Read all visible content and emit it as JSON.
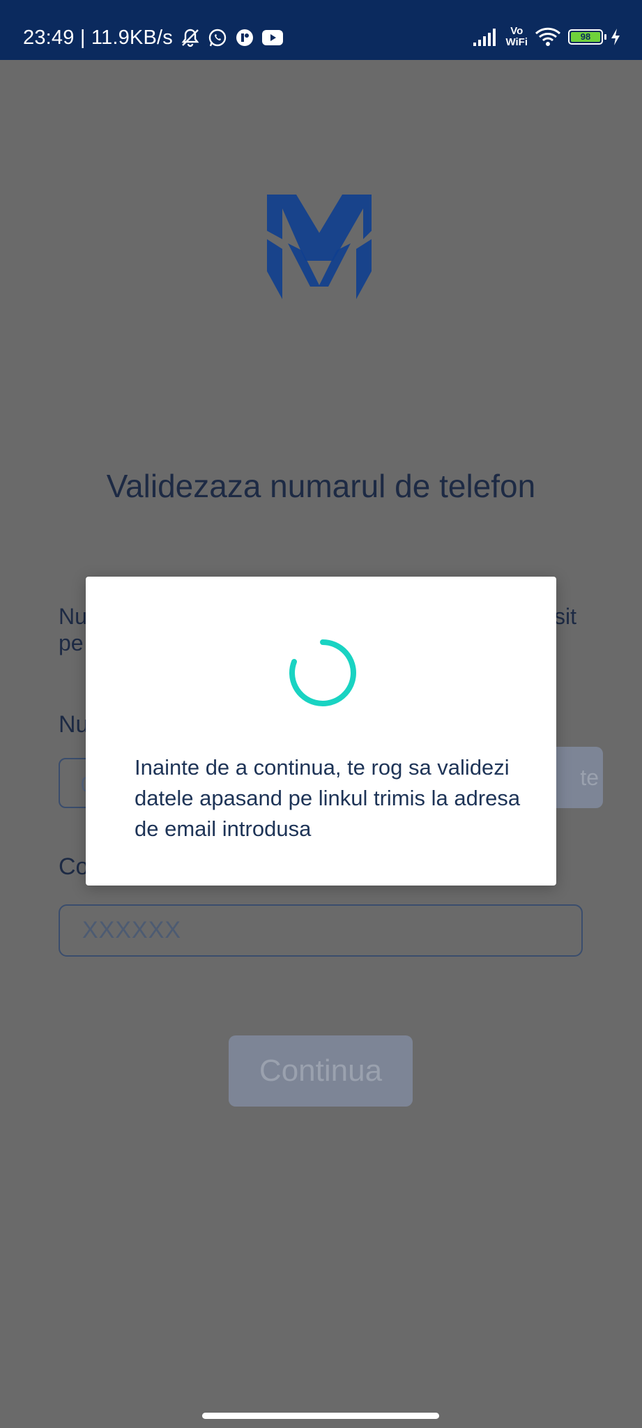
{
  "status_bar": {
    "time_speed": "23:49 | 11.9KB/s",
    "vowifi_line1": "Vo",
    "vowifi_line2": "WiFi",
    "battery_level": "98",
    "icons": [
      "bell-muted-icon",
      "whatsapp-icon",
      "app-icon",
      "youtube-icon",
      "signal-icon",
      "wifi-icon",
      "battery-icon",
      "charging-icon"
    ]
  },
  "page": {
    "title": "Validezaza numarul de telefon",
    "description_left": "Nu\npe",
    "description_right": "sit",
    "phone_label": "Nu",
    "phone_placeholder_fragment": "0",
    "send_button_fragment": "te",
    "code_label": "Co",
    "code_placeholder": "XXXXXX",
    "continue_label": "Continua"
  },
  "modal": {
    "message": "Inainte de a continua, te rog sa validezi datele apasand pe linkul trimis la adresa de email introdusa"
  },
  "colors": {
    "status_bar": "#0b2a5e",
    "overlay": "#6a6a6a",
    "spinner": "#19d3c2",
    "logo": "#0f3f8f"
  }
}
